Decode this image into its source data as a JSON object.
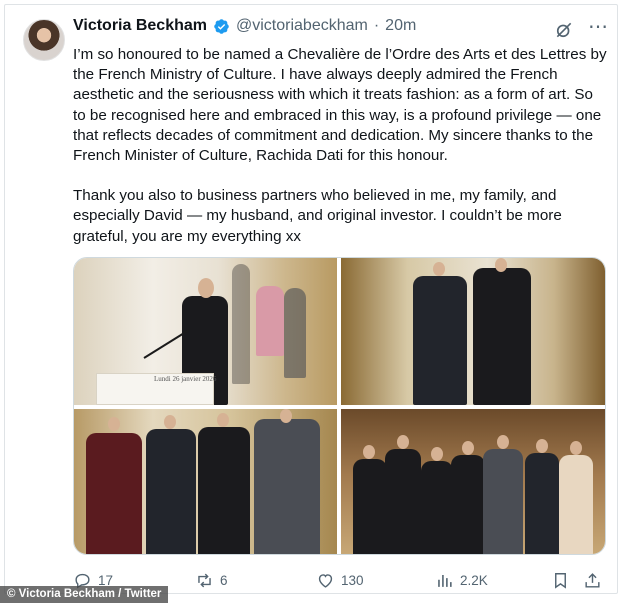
{
  "tweet": {
    "display_name": "Victoria Beckham",
    "handle": "@victoriabeckham",
    "separator": "·",
    "time": "20m",
    "paragraph_1": "I’m so honoured to be named a Chevalière de l’Ordre des Arts et des Lettres by the French Ministry of Culture. I have always deeply admired the French aesthetic and the seriousness with which it treats fashion: as a form of art. So to be recognised here and embraced in this way, is a profound privilege — one that reflects decades of commitment and dedication. My sincere thanks to the French Minister of Culture, Rachida Dati for this honour.",
    "paragraph_2": "Thank you also to business partners who believed in me, my family, and especially David — my husband, and original investor. I couldn’t be more grateful, you are my everything xx",
    "lectern_text": "Lundi 26 janvier 2026"
  },
  "icons": {
    "verified": "verified-badge-icon",
    "grok": "grok-icon",
    "more": "more-icon",
    "reply": "reply-icon",
    "repost": "repost-icon",
    "like": "like-icon",
    "views": "views-icon",
    "bookmark": "bookmark-icon",
    "share": "share-icon"
  },
  "stats": {
    "replies": "17",
    "reposts": "6",
    "likes": "130",
    "views": "2.2K"
  },
  "credit": "© Victoria Beckham / Twitter",
  "colors": {
    "verified": "#1d9bf0",
    "text": "#0f1419",
    "muted": "#536471",
    "border": "#cfd9de"
  }
}
